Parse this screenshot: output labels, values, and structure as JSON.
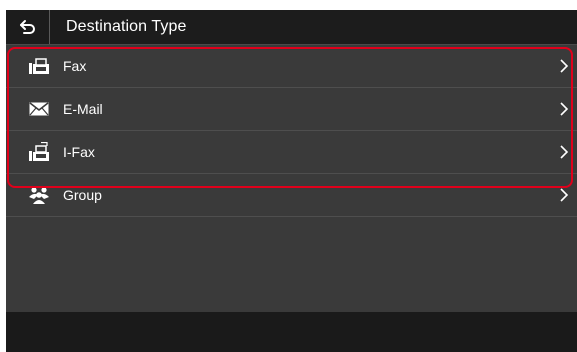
{
  "header": {
    "back_icon": "back-arrow-icon",
    "title": "Destination Type"
  },
  "items": [
    {
      "label": "Fax",
      "icon": "fax-icon"
    },
    {
      "label": "E-Mail",
      "icon": "email-icon"
    },
    {
      "label": "I-Fax",
      "icon": "ifax-icon"
    },
    {
      "label": "Group",
      "icon": "group-icon"
    }
  ],
  "colors": {
    "background": "#3a3a3a",
    "header": "#1c1c1c",
    "highlight": "#e0001b",
    "text": "#ffffff"
  }
}
